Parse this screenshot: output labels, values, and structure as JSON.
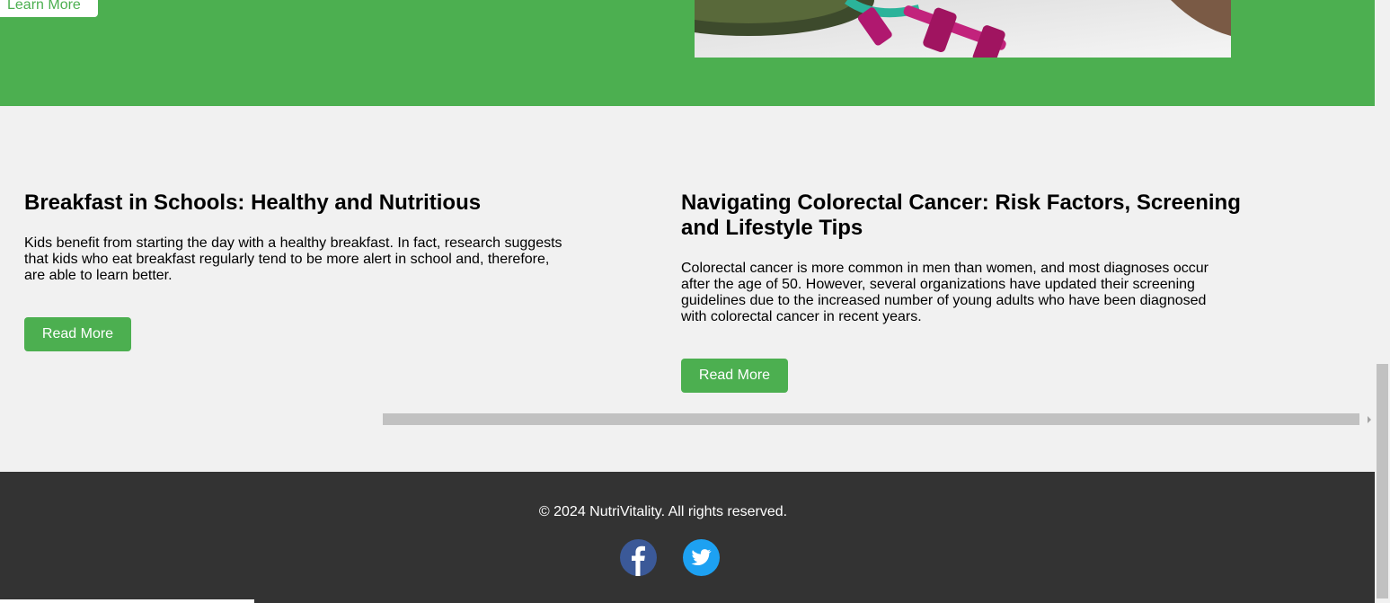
{
  "colors": {
    "brand": "#4caf50",
    "footer_bg": "#333333",
    "page_bg": "#f1f1f1"
  },
  "hero": {
    "learn_more_label": "Learn More"
  },
  "articles": [
    {
      "title": "Breakfast in Schools: Healthy and Nutritious",
      "excerpt": "Kids benefit from starting the day with a healthy breakfast. In fact, research suggests that kids who eat breakfast regularly tend to be more alert in school and, therefore, are able to learn better.",
      "button_label": "Read More"
    },
    {
      "title": "Navigating Colorectal Cancer: Risk Factors, Screening and Lifestyle Tips",
      "excerpt": "Colorectal cancer is more common in men than women, and most diagnoses occur after the age of 50. However, several organizations have updated their screening guidelines due to the increased number of young adults who have been diagnosed with colorectal cancer in recent years.",
      "button_label": "Read More"
    }
  ],
  "footer": {
    "copyright": "© 2024 NutriVitality. All rights reserved.",
    "social": [
      {
        "icon": "facebook-icon"
      },
      {
        "icon": "twitter-icon"
      }
    ]
  }
}
